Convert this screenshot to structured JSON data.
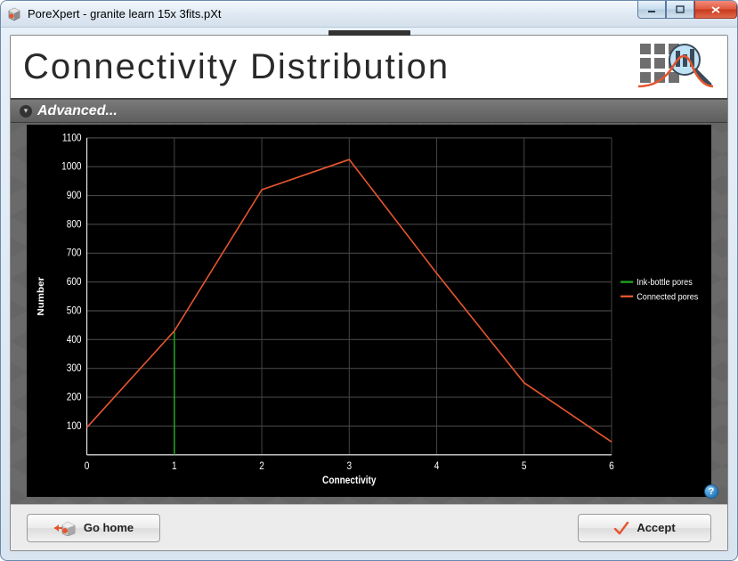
{
  "window": {
    "title": "PoreXpert - granite learn 15x 3fits.pXt"
  },
  "header": {
    "title": "Connectivity Distribution"
  },
  "advanced": {
    "label": "Advanced..."
  },
  "chart_data": {
    "type": "line",
    "title": "",
    "xlabel": "Connectivity",
    "ylabel": "Number",
    "xlim": [
      0,
      6
    ],
    "ylim": [
      0,
      1100
    ],
    "x_ticks": [
      0,
      1,
      2,
      3,
      4,
      5,
      6
    ],
    "y_ticks": [
      100,
      200,
      300,
      400,
      500,
      600,
      700,
      800,
      900,
      1000,
      1100
    ],
    "series": [
      {
        "name": "Ink-bottle pores",
        "color": "#1fa51f",
        "x": [
          1,
          1
        ],
        "y": [
          0,
          430
        ]
      },
      {
        "name": "Connected pores",
        "color": "#e5552e",
        "x": [
          0,
          1,
          2,
          3,
          4,
          5,
          6
        ],
        "y": [
          95,
          430,
          920,
          1025,
          630,
          250,
          45
        ]
      }
    ]
  },
  "legend": {
    "items": [
      {
        "label": "Ink-bottle pores",
        "color": "#1fa51f"
      },
      {
        "label": "Connected pores",
        "color": "#e5552e"
      }
    ]
  },
  "help": {
    "symbol": "?"
  },
  "footer": {
    "go_home_label": "Go home",
    "accept_label": "Accept"
  }
}
